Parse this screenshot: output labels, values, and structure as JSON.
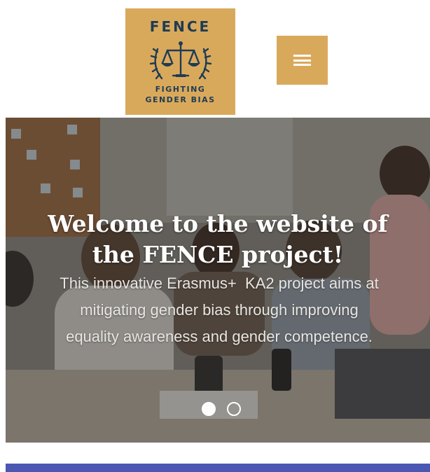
{
  "header": {
    "logo": {
      "title": "FENCE",
      "tagline_line1": "FIGHTING",
      "tagline_line2": "GENDER BIAS",
      "background_color": "#d9a95b",
      "text_color": "#1f3b55",
      "emblem_icon": "scales-of-justice-with-laurel-icon"
    },
    "menu_button": {
      "icon": "hamburger-menu-icon",
      "background_color": "#d9a95b"
    }
  },
  "hero": {
    "title_line1": "Welcome to the website of",
    "title_line2": "the FENCE project!",
    "subtitle_line1": "This innovative Erasmus+  KA2 project aims at",
    "subtitle_line2": "mitigating gender bias through improving",
    "subtitle_line3": "equality awareness and gender competence.",
    "slides_total": 2,
    "active_slide": 1
  },
  "colors": {
    "accent": "#d9a95b",
    "bottom_bar": "#4a58b3"
  }
}
